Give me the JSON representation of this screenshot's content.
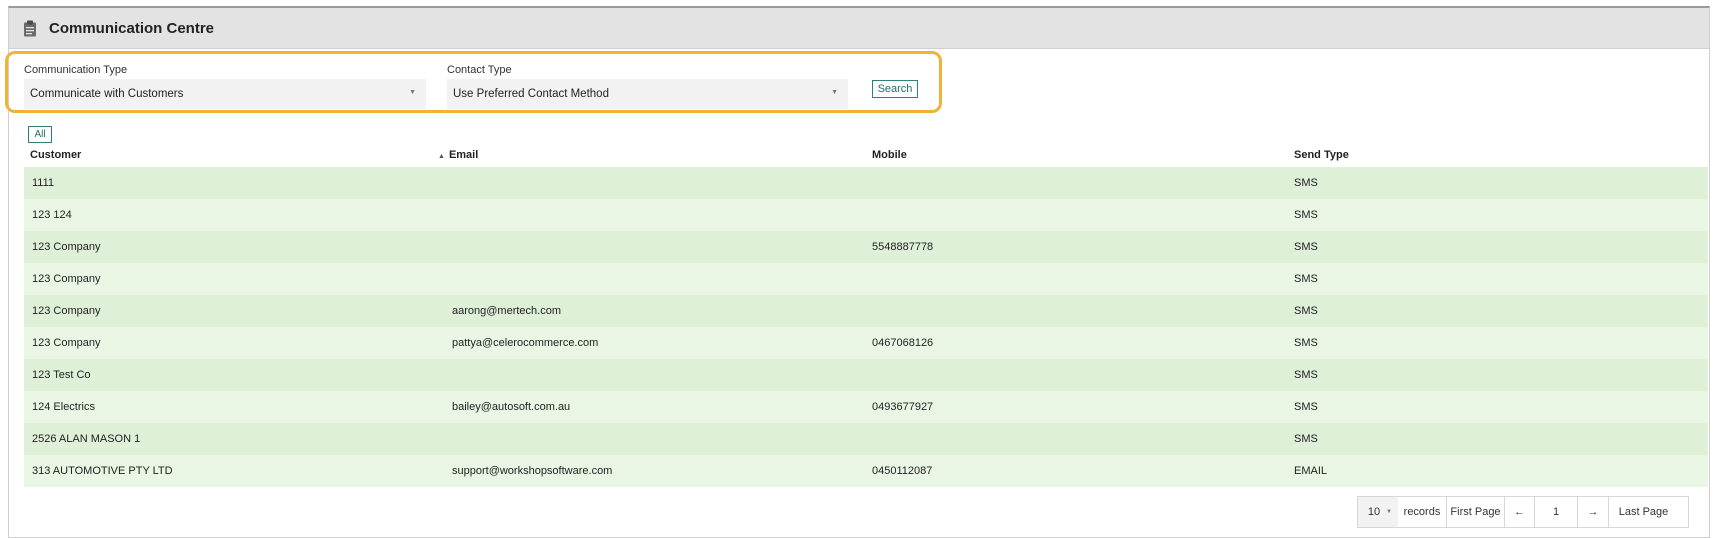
{
  "header": {
    "title": "Communication Centre",
    "icon": "clipboard-icon"
  },
  "filters": {
    "communication_type": {
      "label": "Communication Type",
      "value": "Communicate with Customers"
    },
    "contact_type": {
      "label": "Contact Type",
      "value": "Use Preferred Contact Method"
    },
    "search_label": "Search",
    "highlight_color": "#f0b339"
  },
  "all_label": "All",
  "table": {
    "columns": [
      "Customer",
      "Email",
      "Mobile",
      "Send Type"
    ],
    "rows": [
      [
        "1111",
        "",
        "",
        "SMS"
      ],
      [
        "123 124",
        "",
        "",
        "SMS"
      ],
      [
        "123 Company",
        "",
        "5548887778",
        "SMS"
      ],
      [
        "123 Company",
        "",
        "",
        "SMS"
      ],
      [
        "123 Company",
        "aarong@mertech.com",
        "",
        "SMS"
      ],
      [
        "123 Company",
        "pattya@celerocommerce.com",
        "0467068126",
        "SMS"
      ],
      [
        "123 Test Co",
        "",
        "",
        "SMS"
      ],
      [
        "124 Electrics",
        "bailey@autosoft.com.au",
        "0493677927",
        "SMS"
      ],
      [
        "2526 ALAN MASON 1",
        "",
        "",
        "SMS"
      ],
      [
        "313 AUTOMOTIVE PTY LTD",
        "support@workshopsoftware.com",
        "0450112087",
        "EMAIL"
      ]
    ],
    "row_colors": [
      "#dff0d8",
      "#eaf6e4"
    ]
  },
  "pager": {
    "page_size": "10",
    "records_label": "records",
    "first_label": "First Page",
    "prev_label": "←",
    "page": "1",
    "next_label": "→",
    "last_label": "Last Page"
  }
}
